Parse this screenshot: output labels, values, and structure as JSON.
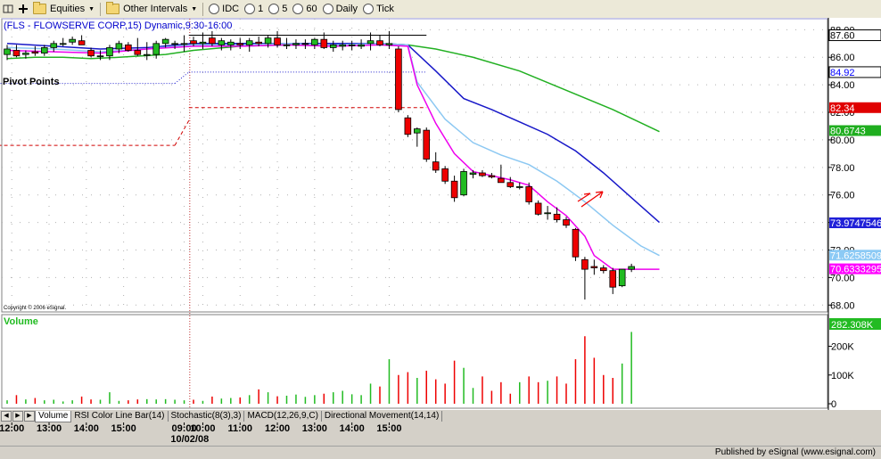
{
  "toolbar": {
    "equities": "Equities",
    "other_intervals": "Other Intervals",
    "intervals": [
      "IDC",
      "1",
      "5",
      "60",
      "Daily",
      "Tick"
    ]
  },
  "tabs": [
    "Volume",
    "RSI Color Line Bar(14)",
    "Stochastic(8(3),3)",
    "MACD(12,26,9,C)",
    "Directional Movement(14,14)"
  ],
  "footer": {
    "published": "Published by eSignal (www.esignal.com)"
  },
  "chart_data": {
    "type": "candlestick",
    "title": "(FLS - FLOWSERVE CORP,15) Dynamic,9:30-16:00",
    "study_label": "Pivot Points",
    "copyright": "Copyright © 2006 eSignal.",
    "date_label": "10/02/08",
    "x_ticks": [
      {
        "bar": 0.5,
        "label": "12:00"
      },
      {
        "bar": 4.5,
        "label": "13:00"
      },
      {
        "bar": 8.5,
        "label": "14:00"
      },
      {
        "bar": 12.5,
        "label": "15:00"
      },
      {
        "bar": 19,
        "label": "09:00"
      },
      {
        "bar": 21,
        "label": "10:00"
      },
      {
        "bar": 25,
        "label": "11:00"
      },
      {
        "bar": 29,
        "label": "12:00"
      },
      {
        "bar": 33,
        "label": "13:00"
      },
      {
        "bar": 37,
        "label": "14:00"
      },
      {
        "bar": 41,
        "label": "15:00"
      }
    ],
    "price_axis": {
      "ylim": [
        67.5,
        88.8
      ],
      "ticks": [
        68,
        70,
        72,
        74,
        76,
        78,
        80,
        82,
        84,
        86,
        88
      ],
      "hidden_tick_labels": [],
      "markers": [
        {
          "value": 87.6,
          "label": "87.60",
          "color": "#000000",
          "text": "#000000",
          "bg": "#ffffff"
        },
        {
          "value": 84.92,
          "label": "84.92",
          "color": "#0000ff",
          "text": "#0000ff",
          "bg": "#ffffff"
        },
        {
          "value": 82.34,
          "label": "82.34",
          "color": "#ff0000",
          "text": "#ffffff",
          "bg": "#e00000"
        },
        {
          "value": 80.6743,
          "label": "80.6743",
          "color": "#19b819",
          "text": "#ffffff",
          "bg": "#1fae1f"
        },
        {
          "value": 73.9747546,
          "label": "73.9747546",
          "color": "#1a1ad0",
          "text": "#ffffff",
          "bg": "#2020d8"
        },
        {
          "value": 71.6258509,
          "label": "71.6258509",
          "color": "#7fc4f5",
          "text": "#ffffff",
          "bg": "#8ccaf5"
        },
        {
          "value": 70.6333295,
          "label": "70.6333295",
          "color": "#ff00ff",
          "text": "#ffffff",
          "bg": "#ff00ff"
        }
      ]
    },
    "volume_axis": {
      "ylim": [
        0,
        282308
      ],
      "ticks": [
        {
          "value": 0,
          "label": "0"
        },
        {
          "value": 100000,
          "label": "100K"
        },
        {
          "value": 200000,
          "label": "200K"
        }
      ],
      "last_label": "282.308K",
      "title": "Volume"
    },
    "candles": [
      {
        "o": 86.2,
        "h": 86.9,
        "l": 85.8,
        "c": 86.6,
        "v": 12000
      },
      {
        "o": 86.5,
        "h": 86.9,
        "l": 86.0,
        "c": 86.1,
        "v": 30000
      },
      {
        "o": 86.2,
        "h": 86.5,
        "l": 85.9,
        "c": 86.3,
        "v": 15000
      },
      {
        "o": 86.4,
        "h": 86.8,
        "l": 86.1,
        "c": 86.3,
        "v": 20000
      },
      {
        "o": 86.3,
        "h": 86.9,
        "l": 86.1,
        "c": 86.7,
        "v": 12000
      },
      {
        "o": 86.7,
        "h": 87.2,
        "l": 86.4,
        "c": 87.0,
        "v": 14000
      },
      {
        "o": 87.0,
        "h": 87.4,
        "l": 86.8,
        "c": 87.0,
        "v": 8000
      },
      {
        "o": 87.1,
        "h": 87.5,
        "l": 86.9,
        "c": 87.3,
        "v": 12000
      },
      {
        "o": 87.2,
        "h": 87.6,
        "l": 86.9,
        "c": 86.9,
        "v": 25000
      },
      {
        "o": 86.5,
        "h": 86.7,
        "l": 86.0,
        "c": 86.1,
        "v": 15000
      },
      {
        "o": 86.1,
        "h": 86.5,
        "l": 85.8,
        "c": 86.1,
        "v": 14000
      },
      {
        "o": 86.1,
        "h": 86.9,
        "l": 85.8,
        "c": 86.7,
        "v": 40000
      },
      {
        "o": 86.6,
        "h": 87.2,
        "l": 86.3,
        "c": 87.0,
        "v": 10000
      },
      {
        "o": 86.9,
        "h": 87.1,
        "l": 86.4,
        "c": 86.5,
        "v": 12000
      },
      {
        "o": 86.5,
        "h": 87.4,
        "l": 86.1,
        "c": 86.2,
        "v": 15000
      },
      {
        "o": 86.2,
        "h": 87.1,
        "l": 85.8,
        "c": 86.2,
        "v": 16000
      },
      {
        "o": 86.2,
        "h": 87.2,
        "l": 85.9,
        "c": 87.0,
        "v": 15000
      },
      {
        "o": 87.0,
        "h": 87.4,
        "l": 86.7,
        "c": 87.3,
        "v": 16000
      },
      {
        "o": 87.0,
        "h": 87.2,
        "l": 86.6,
        "c": 87.0,
        "v": 14000
      },
      {
        "o": 87.0,
        "h": 87.6,
        "l": 86.4,
        "c": 87.0,
        "v": 12000
      },
      {
        "o": 87.2,
        "h": 87.5,
        "l": 86.8,
        "c": 87.0,
        "v": 14000
      },
      {
        "o": 87.0,
        "h": 87.8,
        "l": 86.6,
        "c": 87.1,
        "v": 10000
      },
      {
        "o": 87.4,
        "h": 87.9,
        "l": 86.8,
        "c": 87.0,
        "v": 25000
      },
      {
        "o": 86.9,
        "h": 87.4,
        "l": 86.5,
        "c": 87.2,
        "v": 18000
      },
      {
        "o": 86.9,
        "h": 87.3,
        "l": 86.5,
        "c": 87.1,
        "v": 20000
      },
      {
        "o": 87.0,
        "h": 87.4,
        "l": 86.6,
        "c": 86.9,
        "v": 22000
      },
      {
        "o": 86.9,
        "h": 87.4,
        "l": 86.4,
        "c": 87.2,
        "v": 30000
      },
      {
        "o": 87.1,
        "h": 87.5,
        "l": 86.8,
        "c": 87.0,
        "v": 50000
      },
      {
        "o": 87.0,
        "h": 87.6,
        "l": 86.7,
        "c": 87.4,
        "v": 40000
      },
      {
        "o": 87.4,
        "h": 87.9,
        "l": 86.7,
        "c": 86.9,
        "v": 26000
      },
      {
        "o": 86.9,
        "h": 87.4,
        "l": 86.6,
        "c": 86.9,
        "v": 28000
      },
      {
        "o": 86.9,
        "h": 87.3,
        "l": 86.6,
        "c": 87.0,
        "v": 32000
      },
      {
        "o": 87.0,
        "h": 87.3,
        "l": 86.6,
        "c": 87.0,
        "v": 24000
      },
      {
        "o": 86.9,
        "h": 87.4,
        "l": 86.6,
        "c": 87.3,
        "v": 30000
      },
      {
        "o": 87.3,
        "h": 87.8,
        "l": 86.6,
        "c": 86.7,
        "v": 35000
      },
      {
        "o": 86.7,
        "h": 87.2,
        "l": 86.4,
        "c": 86.9,
        "v": 40000
      },
      {
        "o": 86.8,
        "h": 87.2,
        "l": 86.5,
        "c": 86.9,
        "v": 45000
      },
      {
        "o": 86.9,
        "h": 87.2,
        "l": 86.5,
        "c": 86.9,
        "v": 33000
      },
      {
        "o": 86.8,
        "h": 87.3,
        "l": 86.6,
        "c": 86.9,
        "v": 30000
      },
      {
        "o": 87.0,
        "h": 87.8,
        "l": 86.5,
        "c": 87.2,
        "v": 70000
      },
      {
        "o": 87.2,
        "h": 87.6,
        "l": 86.8,
        "c": 86.9,
        "v": 60000
      },
      {
        "o": 86.9,
        "h": 87.9,
        "l": 86.6,
        "c": 87.0,
        "v": 155000
      },
      {
        "o": 86.6,
        "h": 86.8,
        "l": 82.0,
        "c": 82.2,
        "v": 100000
      },
      {
        "o": 81.6,
        "h": 81.8,
        "l": 80.2,
        "c": 80.4,
        "v": 110000
      },
      {
        "o": 80.5,
        "h": 80.9,
        "l": 79.5,
        "c": 80.8,
        "v": 90000
      },
      {
        "o": 80.7,
        "h": 80.9,
        "l": 78.4,
        "c": 78.6,
        "v": 115000
      },
      {
        "o": 78.4,
        "h": 79.1,
        "l": 77.6,
        "c": 77.8,
        "v": 85000
      },
      {
        "o": 77.9,
        "h": 78.1,
        "l": 76.8,
        "c": 77.0,
        "v": 70000
      },
      {
        "o": 77.0,
        "h": 77.4,
        "l": 75.5,
        "c": 75.8,
        "v": 150000
      },
      {
        "o": 76.0,
        "h": 77.9,
        "l": 75.9,
        "c": 77.7,
        "v": 125000
      },
      {
        "o": 77.5,
        "h": 77.8,
        "l": 77.2,
        "c": 77.6,
        "v": 55000
      },
      {
        "o": 77.6,
        "h": 77.8,
        "l": 77.3,
        "c": 77.4,
        "v": 95000
      },
      {
        "o": 77.4,
        "h": 77.6,
        "l": 77.2,
        "c": 77.3,
        "v": 45000
      },
      {
        "o": 77.2,
        "h": 78.2,
        "l": 76.9,
        "c": 76.9,
        "v": 75000
      },
      {
        "o": 76.9,
        "h": 77.3,
        "l": 76.5,
        "c": 76.6,
        "v": 35000
      },
      {
        "o": 76.6,
        "h": 76.9,
        "l": 76.4,
        "c": 76.6,
        "v": 75000
      },
      {
        "o": 76.6,
        "h": 76.9,
        "l": 75.3,
        "c": 75.5,
        "v": 95000
      },
      {
        "o": 75.4,
        "h": 75.6,
        "l": 74.5,
        "c": 74.6,
        "v": 75000
      },
      {
        "o": 74.7,
        "h": 75.2,
        "l": 74.2,
        "c": 74.7,
        "v": 80000
      },
      {
        "o": 74.6,
        "h": 75.1,
        "l": 74.0,
        "c": 74.2,
        "v": 95000
      },
      {
        "o": 74.2,
        "h": 74.4,
        "l": 73.6,
        "c": 73.8,
        "v": 70000
      },
      {
        "o": 73.5,
        "h": 73.6,
        "l": 71.2,
        "c": 71.5,
        "v": 155000
      },
      {
        "o": 71.3,
        "h": 71.5,
        "l": 68.4,
        "c": 70.6,
        "v": 235000
      },
      {
        "o": 70.8,
        "h": 71.3,
        "l": 70.2,
        "c": 70.7,
        "v": 160000
      },
      {
        "o": 70.7,
        "h": 70.9,
        "l": 70.3,
        "c": 70.5,
        "v": 100000
      },
      {
        "o": 70.5,
        "h": 70.7,
        "l": 68.8,
        "c": 69.3,
        "v": 90000
      },
      {
        "o": 69.4,
        "h": 70.6,
        "l": 69.3,
        "c": 70.6,
        "v": 140000
      },
      {
        "o": 70.6,
        "h": 71.0,
        "l": 70.4,
        "c": 70.8,
        "v": 250000
      }
    ],
    "lines": [
      {
        "name": "green",
        "color": "#22b022",
        "points": [
          [
            0,
            85.9
          ],
          [
            3,
            86.0
          ],
          [
            6,
            86.0
          ],
          [
            9,
            85.9
          ],
          [
            12,
            86.0
          ],
          [
            17,
            86.2
          ],
          [
            20,
            86.5
          ],
          [
            25,
            86.8
          ],
          [
            30,
            86.9
          ],
          [
            35,
            87.0
          ],
          [
            40,
            87.0
          ],
          [
            43,
            86.9
          ],
          [
            46,
            86.6
          ],
          [
            50,
            86.0
          ],
          [
            55,
            85.0
          ],
          [
            60,
            83.6
          ],
          [
            65,
            82.2
          ],
          [
            70,
            80.6
          ]
        ]
      },
      {
        "name": "blue",
        "color": "#1818c8",
        "points": [
          [
            0,
            87.0
          ],
          [
            5,
            86.8
          ],
          [
            10,
            86.6
          ],
          [
            15,
            86.7
          ],
          [
            20,
            87.0
          ],
          [
            25,
            87.0
          ],
          [
            30,
            87.0
          ],
          [
            35,
            87.0
          ],
          [
            40,
            87.0
          ],
          [
            43,
            86.9
          ],
          [
            46,
            85.0
          ],
          [
            49,
            83.0
          ],
          [
            52,
            82.2
          ],
          [
            55,
            81.3
          ],
          [
            58,
            80.4
          ],
          [
            61,
            79.2
          ],
          [
            64,
            77.6
          ],
          [
            67,
            75.8
          ],
          [
            70,
            74.0
          ]
        ]
      },
      {
        "name": "lightblue",
        "color": "#8cc8f2",
        "points": [
          [
            0,
            86.7
          ],
          [
            5,
            86.6
          ],
          [
            10,
            86.4
          ],
          [
            15,
            86.6
          ],
          [
            20,
            86.9
          ],
          [
            25,
            86.9
          ],
          [
            30,
            87.0
          ],
          [
            35,
            86.9
          ],
          [
            40,
            87.0
          ],
          [
            43,
            86.9
          ],
          [
            44,
            84.2
          ],
          [
            47,
            81.5
          ],
          [
            50,
            79.8
          ],
          [
            53,
            78.9
          ],
          [
            56,
            78.2
          ],
          [
            59,
            77.0
          ],
          [
            62,
            75.5
          ],
          [
            65,
            73.8
          ],
          [
            68,
            72.3
          ],
          [
            70,
            71.6
          ]
        ]
      },
      {
        "name": "magenta",
        "color": "#ee00ee",
        "points": [
          [
            0,
            86.5
          ],
          [
            5,
            86.4
          ],
          [
            10,
            86.3
          ],
          [
            15,
            86.6
          ],
          [
            20,
            86.8
          ],
          [
            25,
            86.8
          ],
          [
            30,
            86.9
          ],
          [
            35,
            86.8
          ],
          [
            40,
            86.9
          ],
          [
            43,
            86.8
          ],
          [
            44,
            84.0
          ],
          [
            46,
            81.2
          ],
          [
            48,
            79.0
          ],
          [
            50,
            77.7
          ],
          [
            52,
            77.4
          ],
          [
            54,
            77.1
          ],
          [
            56,
            76.7
          ],
          [
            58,
            75.5
          ],
          [
            60,
            74.5
          ],
          [
            62,
            73.0
          ],
          [
            63,
            71.6
          ],
          [
            65,
            70.6
          ],
          [
            70,
            70.6
          ]
        ]
      }
    ],
    "pivot_segments": [
      {
        "from": -1.0,
        "to": 18.0,
        "value": 79.6,
        "color": "#d00000"
      },
      {
        "from": 18.0,
        "to": 19.5,
        "value": 79.6,
        "value2": 81.4,
        "color": "#d00000"
      },
      {
        "from": 19.5,
        "to": 45.0,
        "value": 82.34,
        "color": "#d00000"
      },
      {
        "from": -1.0,
        "to": 18.0,
        "value": 84.1,
        "color": "#2020d0"
      },
      {
        "from": 18.0,
        "to": 19.5,
        "value": 84.1,
        "value2": 84.92,
        "color": "#2020d0"
      },
      {
        "from": 19.5,
        "to": 45.0,
        "value": 84.92,
        "color": "#2020d0"
      },
      {
        "from": 19.5,
        "to": 45.0,
        "value": 87.6,
        "color": "#000000",
        "solid": true
      }
    ]
  }
}
